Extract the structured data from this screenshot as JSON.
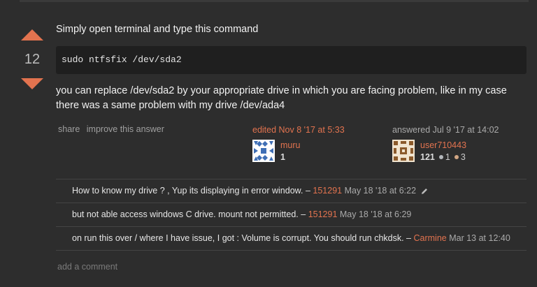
{
  "vote": {
    "count": "12"
  },
  "answer": {
    "intro": "Simply open terminal and type this command",
    "code": "sudo ntfsfix /dev/sda2",
    "body": "you can replace /dev/sda2 by your appropriate drive in which you are facing problem, like in my case there was a same problem with my drive /dev/ada4"
  },
  "menu": {
    "share": "share",
    "improve": "improve this answer"
  },
  "editor": {
    "action": "edited Nov 8 '17 at 5:33",
    "name": "muru",
    "rep": "1"
  },
  "owner": {
    "action": "answered Jul 9 '17 at 14:02",
    "name": "user710443",
    "rep": "121",
    "silver": "1",
    "bronze": "3"
  },
  "comments": [
    {
      "text": "How to know my drive ? , Yup its displaying in error window. –",
      "user": "151291",
      "date": "May 18 '18 at 6:22"
    },
    {
      "text": "but not able access windows C drive. mount not permitted. –",
      "user": "151291",
      "date": "May 18 '18 at 6:29"
    },
    {
      "text": "on run this over / where I have issue, I got : Volume is corrupt. You should run chkdsk. –",
      "user": "Carmine",
      "date": "Mar 13 at 12:40"
    }
  ],
  "add_comment": "add a comment",
  "colors": {
    "accent": "#e2734f",
    "background": "#2d2d2d",
    "code_bg": "#1f1f1f"
  }
}
